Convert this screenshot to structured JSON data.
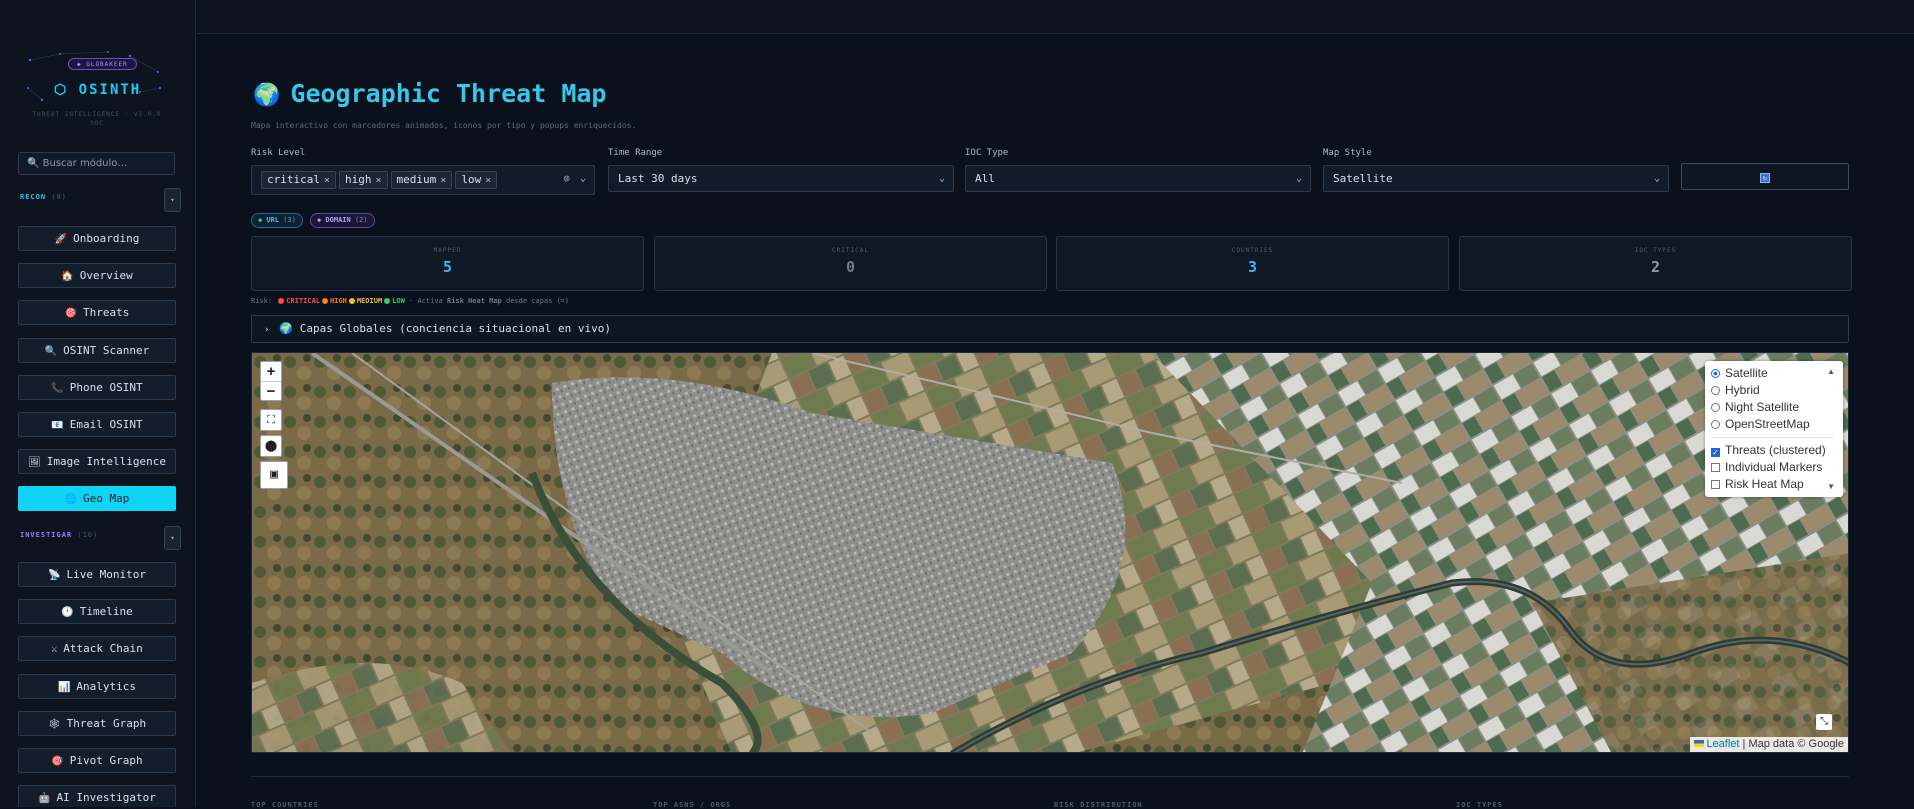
{
  "sidebar": {
    "badge": "◆ GLOBAKEER",
    "logo": "⬡ OSINTH",
    "subtitle": "THREAT INTELLIGENCE · V3.0.0 SOC",
    "search_placeholder": "🔍 Buscar módulo…",
    "recon_section": {
      "label": "RECON",
      "count": "(8)"
    },
    "investigar_section": {
      "label": "INVESTIGAR",
      "count": "(10)"
    },
    "recon_items": [
      {
        "icon": "🚀",
        "label": "Onboarding"
      },
      {
        "icon": "🏠",
        "label": "Overview"
      },
      {
        "icon": "🎯",
        "label": "Threats"
      },
      {
        "icon": "🔍",
        "label": "OSINT Scanner"
      },
      {
        "icon": "📞",
        "label": "Phone OSINT"
      },
      {
        "icon": "📧",
        "label": "Email OSINT"
      },
      {
        "icon": "🖼",
        "label": "Image Intelligence"
      },
      {
        "icon": "🌐",
        "label": "Geo Map"
      }
    ],
    "investigar_items": [
      {
        "icon": "📡",
        "label": "Live Monitor"
      },
      {
        "icon": "🕐",
        "label": "Timeline"
      },
      {
        "icon": "⚔",
        "label": "Attack Chain"
      },
      {
        "icon": "📊",
        "label": "Analytics"
      },
      {
        "icon": "🕸",
        "label": "Threat Graph"
      },
      {
        "icon": "🎯",
        "label": "Pivot Graph"
      },
      {
        "icon": "🤖",
        "label": "AI Investigator"
      }
    ],
    "active_item": "Geo Map"
  },
  "page": {
    "globe": "🌍",
    "title": "Geographic Threat Map",
    "description": "Mapa interactivo con marcadores animados, iconos por tipo y popups enriquecidos."
  },
  "filters": {
    "risk_label": "Risk Level",
    "risk_tags": [
      "critical",
      "high",
      "medium",
      "low"
    ],
    "time_label": "Time Range",
    "time_value": "Last 30 days",
    "ioc_label": "IOC Type",
    "ioc_value": "All",
    "style_label": "Map Style",
    "style_value": "Satellite"
  },
  "chips": {
    "url": {
      "label": "◆ URL",
      "count": "(3)"
    },
    "domain": {
      "label": "◆ DOMAIN",
      "count": "(2)"
    }
  },
  "stats": [
    {
      "label": "MAPPED",
      "value": "5",
      "color": "#3fb6ee"
    },
    {
      "label": "CRITICAL",
      "value": "0",
      "color": "#6f7c8e"
    },
    {
      "label": "COUNTRIES",
      "value": "3",
      "color": "#3fb6ee"
    },
    {
      "label": "IOC TYPES",
      "value": "2",
      "color": "#8c99aa"
    }
  ],
  "risk_legend": {
    "prefix": "Risk:",
    "levels": [
      {
        "label": "CRITICAL",
        "color": "#ff4b4b"
      },
      {
        "label": "HIGH",
        "color": "#ff7a1a"
      },
      {
        "label": "MEDIUM",
        "color": "#f5b82e"
      },
      {
        "label": "LOW",
        "color": "#33cc66"
      }
    ],
    "hint_pre": "· Activa",
    "hint_bold": "Risk Heat Map",
    "hint_post": "desde capas (⌗)"
  },
  "layers_bar": {
    "icon": "🌍",
    "label": "Capas Globales (conciencia situacional en vivo)"
  },
  "map": {
    "zoom_in": "+",
    "zoom_out": "−",
    "base_layers": [
      "Satellite",
      "Hybrid",
      "Night Satellite",
      "OpenStreetMap"
    ],
    "selected_base": "Satellite",
    "overlays": [
      {
        "label": "Threats (clustered)",
        "checked": true
      },
      {
        "label": "Individual Markers",
        "checked": false
      },
      {
        "label": "Risk Heat Map",
        "checked": false
      }
    ],
    "attribution_link": "Leaflet",
    "attribution_text": "| Map data © Google"
  },
  "bottom_headers": [
    "TOP COUNTRIES",
    "TOP ASNS / ORGS",
    "RISK DISTRIBUTION",
    "IOC TYPES"
  ]
}
